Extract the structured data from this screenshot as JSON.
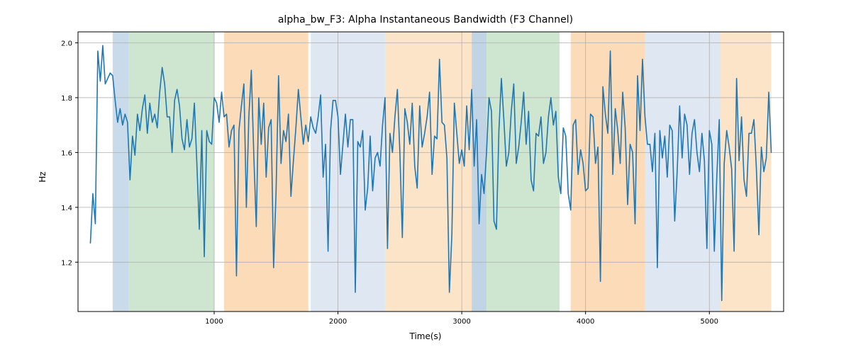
{
  "chart_data": {
    "type": "line",
    "title": "alpha_bw_F3: Alpha Instantaneous Bandwidth (F3 Channel)",
    "xlabel": "Time(s)",
    "ylabel": "Hz",
    "xlim": [
      -100,
      5600
    ],
    "ylim": [
      1.02,
      2.04
    ],
    "xticks": [
      1000,
      2000,
      3000,
      4000,
      5000
    ],
    "yticks": [
      1.2,
      1.4,
      1.6,
      1.8,
      2.0
    ],
    "regions": [
      {
        "x0": 180,
        "x1": 310,
        "color": "#c3d7e8"
      },
      {
        "x0": 310,
        "x1": 1000,
        "color": "#c9e3cb"
      },
      {
        "x0": 1080,
        "x1": 1760,
        "color": "#fbd7b0"
      },
      {
        "x0": 1780,
        "x1": 2380,
        "color": "#dbe6f1"
      },
      {
        "x0": 2380,
        "x1": 3080,
        "color": "#fce1c2"
      },
      {
        "x0": 3080,
        "x1": 3200,
        "color": "#b9cfe2"
      },
      {
        "x0": 3200,
        "x1": 3790,
        "color": "#c9e3cb"
      },
      {
        "x0": 3880,
        "x1": 4480,
        "color": "#fbd7b0"
      },
      {
        "x0": 4480,
        "x1": 5090,
        "color": "#dbe6f1"
      },
      {
        "x0": 5090,
        "x1": 5500,
        "color": "#fce1c2"
      }
    ],
    "x": [
      0,
      20,
      40,
      60,
      80,
      100,
      120,
      140,
      160,
      180,
      200,
      220,
      240,
      260,
      280,
      300,
      320,
      340,
      360,
      380,
      400,
      420,
      440,
      460,
      480,
      500,
      520,
      540,
      560,
      580,
      600,
      620,
      640,
      660,
      680,
      700,
      720,
      740,
      760,
      780,
      800,
      820,
      840,
      860,
      880,
      900,
      920,
      940,
      960,
      980,
      1000,
      1020,
      1040,
      1060,
      1080,
      1100,
      1120,
      1140,
      1160,
      1180,
      1200,
      1220,
      1240,
      1260,
      1280,
      1300,
      1320,
      1340,
      1360,
      1380,
      1400,
      1420,
      1440,
      1460,
      1480,
      1500,
      1520,
      1540,
      1560,
      1580,
      1600,
      1620,
      1640,
      1660,
      1680,
      1700,
      1720,
      1740,
      1760,
      1780,
      1800,
      1820,
      1840,
      1860,
      1880,
      1900,
      1920,
      1940,
      1960,
      1980,
      2000,
      2020,
      2040,
      2060,
      2080,
      2100,
      2120,
      2140,
      2160,
      2180,
      2200,
      2220,
      2240,
      2260,
      2280,
      2300,
      2320,
      2340,
      2360,
      2380,
      2400,
      2420,
      2440,
      2460,
      2480,
      2500,
      2520,
      2540,
      2560,
      2580,
      2600,
      2620,
      2640,
      2660,
      2680,
      2700,
      2720,
      2740,
      2760,
      2780,
      2800,
      2820,
      2840,
      2860,
      2880,
      2900,
      2920,
      2940,
      2960,
      2980,
      3000,
      3020,
      3040,
      3060,
      3080,
      3100,
      3120,
      3140,
      3160,
      3180,
      3200,
      3220,
      3240,
      3260,
      3280,
      3300,
      3320,
      3340,
      3360,
      3380,
      3400,
      3420,
      3440,
      3460,
      3480,
      3500,
      3520,
      3540,
      3560,
      3580,
      3600,
      3620,
      3640,
      3660,
      3680,
      3700,
      3720,
      3740,
      3760,
      3780,
      3800,
      3820,
      3840,
      3860,
      3880,
      3900,
      3920,
      3940,
      3960,
      3980,
      4000,
      4020,
      4040,
      4060,
      4080,
      4100,
      4120,
      4140,
      4160,
      4180,
      4200,
      4220,
      4240,
      4260,
      4280,
      4300,
      4320,
      4340,
      4360,
      4380,
      4400,
      4420,
      4440,
      4460,
      4480,
      4500,
      4520,
      4540,
      4560,
      4580,
      4600,
      4620,
      4640,
      4660,
      4680,
      4700,
      4720,
      4740,
      4760,
      4780,
      4800,
      4820,
      4840,
      4860,
      4880,
      4900,
      4920,
      4940,
      4960,
      4980,
      5000,
      5020,
      5040,
      5060,
      5080,
      5100,
      5120,
      5140,
      5160,
      5180,
      5200,
      5220,
      5240,
      5260,
      5280,
      5300,
      5320,
      5340,
      5360,
      5380,
      5400,
      5420,
      5440,
      5460,
      5480,
      5500
    ],
    "y": [
      1.27,
      1.45,
      1.34,
      1.97,
      1.86,
      1.99,
      1.85,
      1.87,
      1.89,
      1.88,
      1.79,
      1.71,
      1.76,
      1.7,
      1.74,
      1.71,
      1.5,
      1.66,
      1.59,
      1.74,
      1.68,
      1.76,
      1.81,
      1.67,
      1.78,
      1.71,
      1.74,
      1.69,
      1.82,
      1.91,
      1.85,
      1.73,
      1.73,
      1.6,
      1.79,
      1.83,
      1.77,
      1.65,
      1.61,
      1.72,
      1.62,
      1.65,
      1.78,
      1.56,
      1.32,
      1.68,
      1.22,
      1.68,
      1.64,
      1.63,
      1.8,
      1.78,
      1.71,
      1.82,
      1.73,
      1.74,
      1.62,
      1.68,
      1.7,
      1.15,
      1.68,
      1.77,
      1.85,
      1.4,
      1.73,
      1.9,
      1.59,
      1.33,
      1.8,
      1.63,
      1.78,
      1.51,
      1.69,
      1.72,
      1.18,
      1.46,
      1.88,
      1.56,
      1.68,
      1.64,
      1.74,
      1.44,
      1.57,
      1.69,
      1.83,
      1.73,
      1.63,
      1.7,
      1.64,
      1.73,
      1.69,
      1.67,
      1.73,
      1.81,
      1.51,
      1.63,
      1.24,
      1.68,
      1.79,
      1.79,
      1.73,
      1.52,
      1.63,
      1.74,
      1.62,
      1.72,
      1.72,
      1.09,
      1.64,
      1.62,
      1.68,
      1.39,
      1.47,
      1.66,
      1.46,
      1.58,
      1.6,
      1.55,
      1.7,
      1.8,
      1.25,
      1.67,
      1.6,
      1.73,
      1.83,
      1.6,
      1.29,
      1.76,
      1.71,
      1.63,
      1.78,
      1.55,
      1.47,
      1.77,
      1.62,
      1.67,
      1.73,
      1.82,
      1.52,
      1.66,
      1.65,
      1.94,
      1.71,
      1.7,
      1.58,
      1.09,
      1.3,
      1.78,
      1.67,
      1.56,
      1.61,
      1.55,
      1.77,
      1.61,
      1.83,
      1.55,
      1.72,
      1.34,
      1.52,
      1.45,
      1.6,
      1.8,
      1.75,
      1.35,
      1.32,
      1.68,
      1.87,
      1.72,
      1.55,
      1.6,
      1.75,
      1.85,
      1.56,
      1.62,
      1.71,
      1.82,
      1.63,
      1.75,
      1.5,
      1.46,
      1.67,
      1.66,
      1.73,
      1.56,
      1.6,
      1.73,
      1.8,
      1.7,
      1.75,
      1.51,
      1.45,
      1.69,
      1.66,
      1.45,
      1.39,
      1.7,
      1.72,
      1.52,
      1.61,
      1.56,
      1.46,
      1.47,
      1.74,
      1.73,
      1.56,
      1.62,
      1.13,
      1.84,
      1.74,
      1.67,
      1.97,
      1.52,
      1.76,
      1.68,
      1.56,
      1.82,
      1.69,
      1.41,
      1.63,
      1.6,
      1.34,
      1.88,
      1.68,
      1.94,
      1.73,
      1.63,
      1.63,
      1.53,
      1.67,
      1.18,
      1.68,
      1.58,
      1.66,
      1.51,
      1.7,
      1.68,
      1.35,
      1.53,
      1.77,
      1.58,
      1.74,
      1.7,
      1.52,
      1.67,
      1.72,
      1.6,
      1.53,
      1.67,
      1.57,
      1.25,
      1.68,
      1.63,
      1.24,
      1.51,
      1.72,
      1.06,
      1.56,
      1.68,
      1.62,
      1.54,
      1.24,
      1.87,
      1.57,
      1.73,
      1.5,
      1.44,
      1.67,
      1.67,
      1.72,
      1.54,
      1.3,
      1.62,
      1.53,
      1.58,
      1.82,
      1.6
    ]
  }
}
